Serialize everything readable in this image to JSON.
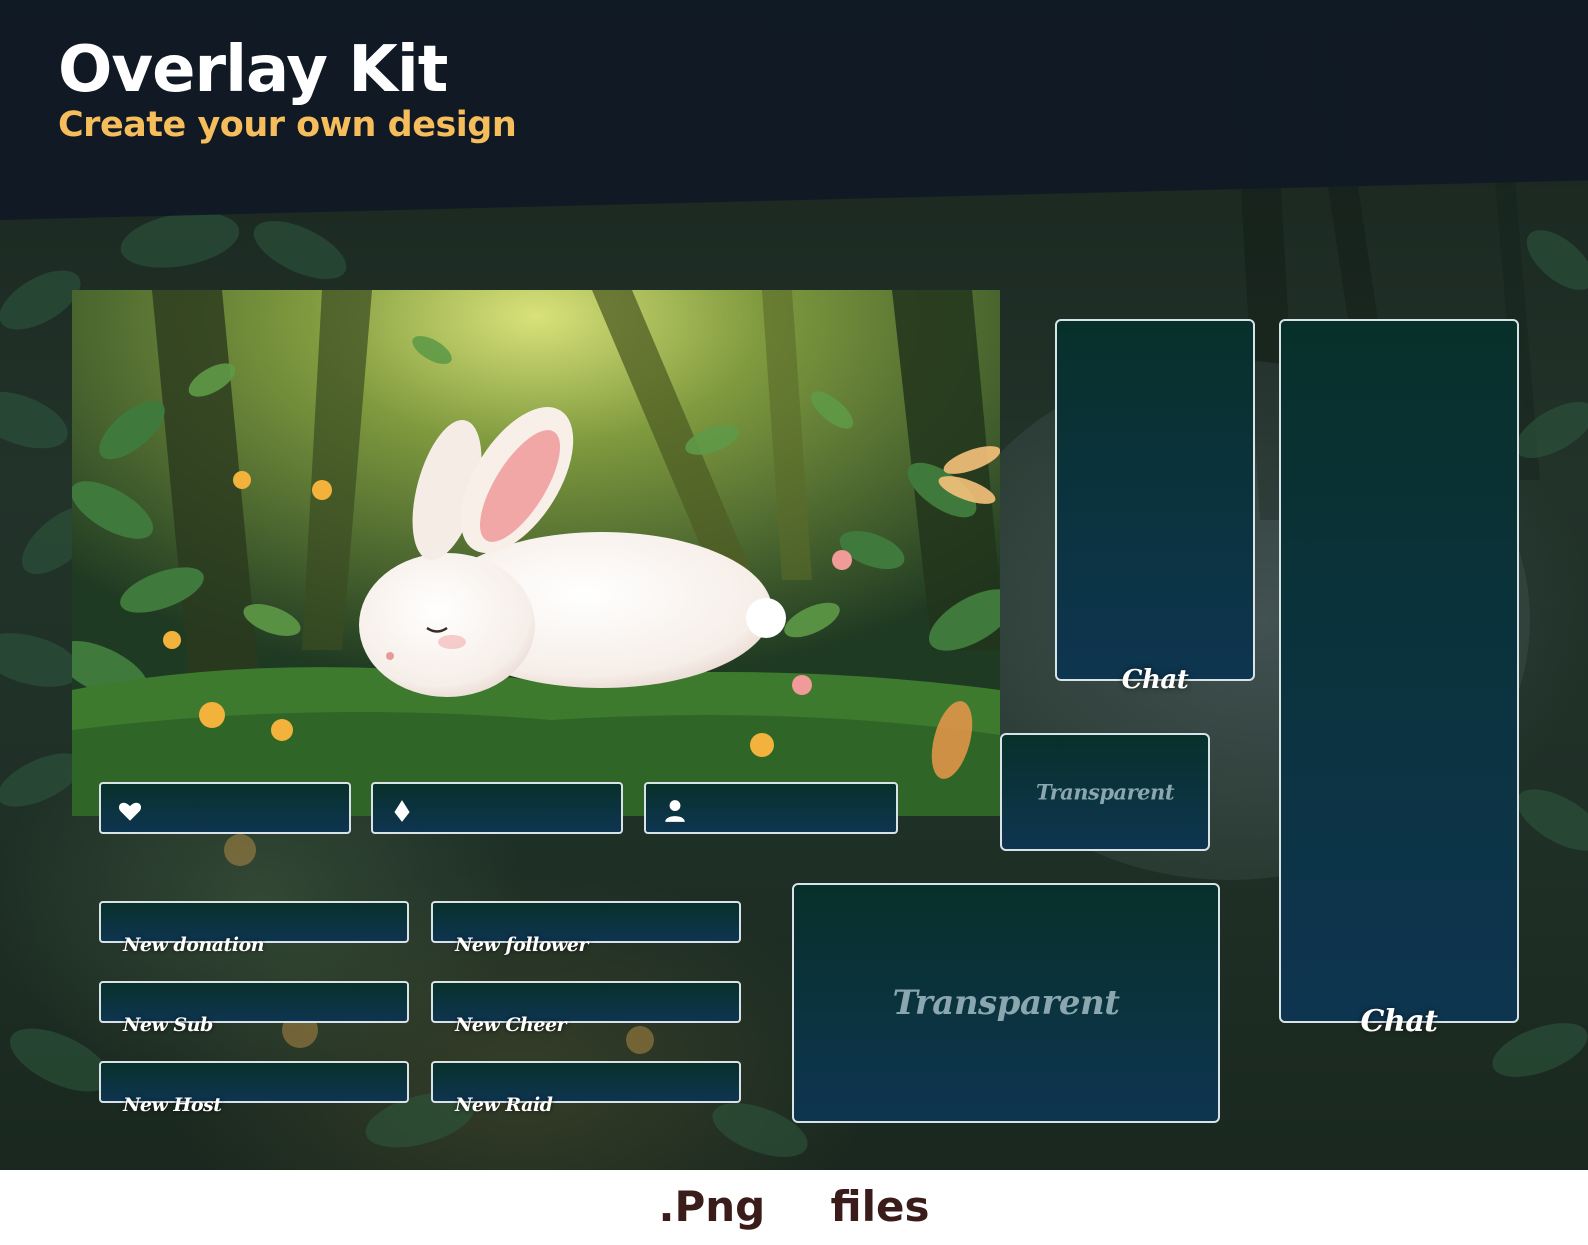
{
  "header": {
    "title": "Overlay Kit",
    "subtitle": "Create your own design"
  },
  "scene": {
    "subject": "sleeping white rabbit in a forest"
  },
  "stat_panels": [
    {
      "icon": "heart-icon"
    },
    {
      "icon": "diamond-icon"
    },
    {
      "icon": "user-icon"
    }
  ],
  "alerts": [
    {
      "label": "New donation"
    },
    {
      "label": "New follower"
    },
    {
      "label": "New Sub"
    },
    {
      "label": "New Cheer"
    },
    {
      "label": "New Host"
    },
    {
      "label": "New Raid"
    }
  ],
  "chat_small": {
    "label": "Chat"
  },
  "chat_tall": {
    "label": "Chat"
  },
  "transparent_small": {
    "label": "Transparent"
  },
  "transparent_large": {
    "label": "Transparent"
  },
  "footer": {
    "text": ".Png  files"
  },
  "colors": {
    "title": "#ffffff",
    "subtitle": "#f5bd5c",
    "panel_top": "#08302a",
    "panel_bottom": "#0e3550",
    "panel_border": "#d9e2e6",
    "footer_text": "#3a1d1a"
  }
}
